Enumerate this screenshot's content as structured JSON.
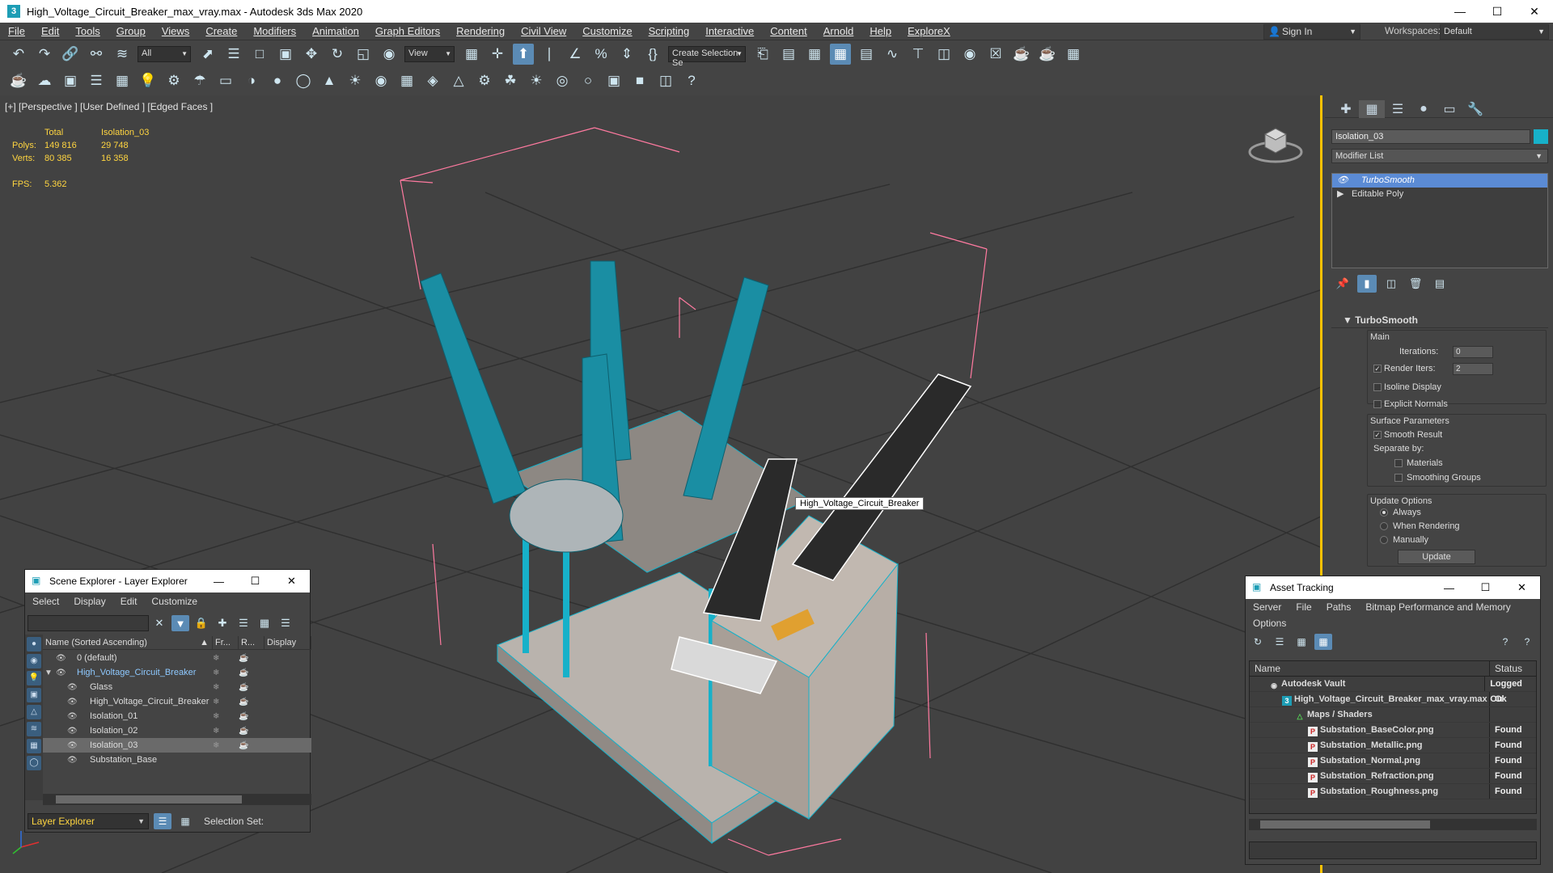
{
  "window": {
    "title": "High_Voltage_Circuit_Breaker_max_vray.max - Autodesk 3ds Max 2020",
    "app_icon": "3"
  },
  "menu": [
    "File",
    "Edit",
    "Tools",
    "Group",
    "Views",
    "Create",
    "Modifiers",
    "Animation",
    "Graph Editors",
    "Rendering",
    "Civil View",
    "Customize",
    "Scripting",
    "Interactive",
    "Content",
    "Arnold",
    "Help",
    "ExploreX"
  ],
  "account": {
    "signin": "Sign In",
    "workspace_label": "Workspaces:",
    "workspace": "Default"
  },
  "toolbar": {
    "filter": "All",
    "view_dropdown": "View",
    "selection_set": "Create Selection Se"
  },
  "viewport": {
    "label": "[+] [Perspective ] [User Defined ] [Edged Faces ]",
    "stats": {
      "total_label": "Total",
      "object": "Isolation_03",
      "polys_label": "Polys:",
      "polys_total": "149 816",
      "polys_obj": "29 748",
      "verts_label": "Verts:",
      "verts_total": "80 385",
      "verts_obj": "16 358"
    },
    "fps_label": "FPS:",
    "fps": "5.362",
    "tooltip": "High_Voltage_Circuit_Breaker"
  },
  "command_panel": {
    "object_name": "Isolation_03",
    "object_color": "#17b1c9",
    "modifier_list": "Modifier List",
    "stack": [
      "TurboSmooth",
      "Editable Poly"
    ],
    "turbosmooth": {
      "title": "TurboSmooth",
      "main": "Main",
      "iterations_label": "Iterations:",
      "iterations": "0",
      "render_iters_label": "Render Iters:",
      "render_iters": "2",
      "isoline": "Isoline Display",
      "explicit": "Explicit Normals",
      "surface": "Surface Parameters",
      "smooth_result": "Smooth Result",
      "separate_by": "Separate by:",
      "materials": "Materials",
      "smoothing_groups": "Smoothing Groups",
      "update_options": "Update Options",
      "always": "Always",
      "when_rendering": "When Rendering",
      "manually": "Manually",
      "update_btn": "Update"
    }
  },
  "scene_explorer": {
    "title": "Scene Explorer - Layer Explorer",
    "menu": [
      "Select",
      "Display",
      "Edit",
      "Customize"
    ],
    "columns": [
      "Name (Sorted Ascending)",
      "Fr...",
      "R...",
      "Display"
    ],
    "rows": [
      {
        "name": "0 (default)"
      },
      {
        "name": "High_Voltage_Circuit_Breaker"
      },
      {
        "name": "Glass"
      },
      {
        "name": "High_Voltage_Circuit_Breaker"
      },
      {
        "name": "Isolation_01"
      },
      {
        "name": "Isolation_02"
      },
      {
        "name": "Isolation_03"
      },
      {
        "name": "Substation_Base"
      }
    ],
    "layer_explorer": "Layer Explorer",
    "selection_set": "Selection Set:"
  },
  "asset_tracking": {
    "title": "Asset Tracking",
    "menu": [
      "Server",
      "File",
      "Paths",
      "Bitmap Performance and Memory",
      "Options"
    ],
    "columns": [
      "Name",
      "Status"
    ],
    "rows": [
      {
        "name": "Autodesk Vault",
        "status": "Logged Ou"
      },
      {
        "name": "High_Voltage_Circuit_Breaker_max_vray.max",
        "status": "Ok"
      },
      {
        "name": "Maps / Shaders",
        "status": ""
      },
      {
        "name": "Substation_BaseColor.png",
        "status": "Found"
      },
      {
        "name": "Substation_Metallic.png",
        "status": "Found"
      },
      {
        "name": "Substation_Normal.png",
        "status": "Found"
      },
      {
        "name": "Substation_Refraction.png",
        "status": "Found"
      },
      {
        "name": "Substation_Roughness.png",
        "status": "Found"
      }
    ]
  }
}
